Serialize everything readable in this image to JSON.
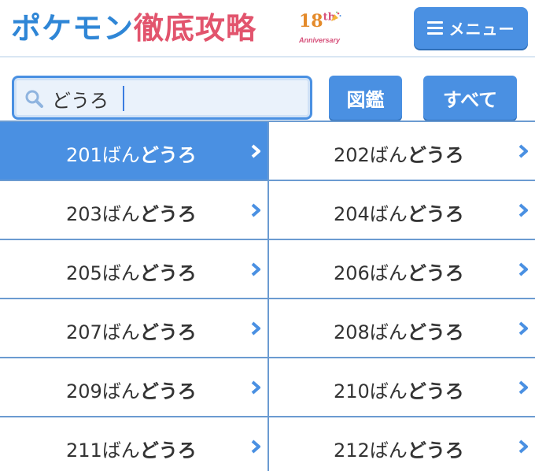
{
  "header": {
    "logo_part1": "ポケモン",
    "logo_part2": "徹底攻略",
    "anniv_number": "18",
    "anniv_suffix": "th",
    "anniv_word": "Anniversary",
    "menu_label": "メニュー"
  },
  "search": {
    "value": "どうろ",
    "zukan_label": "図鑑",
    "all_label": "すべて"
  },
  "routes": [
    {
      "num": "201",
      "suffix": "ばん",
      "road": "どうろ",
      "active": true
    },
    {
      "num": "202",
      "suffix": "ばん",
      "road": "どうろ",
      "active": false
    },
    {
      "num": "203",
      "suffix": "ばん",
      "road": "どうろ",
      "active": false
    },
    {
      "num": "204",
      "suffix": "ばん",
      "road": "どうろ",
      "active": false
    },
    {
      "num": "205",
      "suffix": "ばん",
      "road": "どうろ",
      "active": false
    },
    {
      "num": "206",
      "suffix": "ばん",
      "road": "どうろ",
      "active": false
    },
    {
      "num": "207",
      "suffix": "ばん",
      "road": "どうろ",
      "active": false
    },
    {
      "num": "208",
      "suffix": "ばん",
      "road": "どうろ",
      "active": false
    },
    {
      "num": "209",
      "suffix": "ばん",
      "road": "どうろ",
      "active": false
    },
    {
      "num": "210",
      "suffix": "ばん",
      "road": "どうろ",
      "active": false
    },
    {
      "num": "211",
      "suffix": "ばん",
      "road": "どうろ",
      "active": false
    },
    {
      "num": "212",
      "suffix": "ばん",
      "road": "どうろ",
      "active": false
    }
  ],
  "colors": {
    "accent": "#4a90e2",
    "border": "#6b9bd1",
    "logo_blue": "#2f86d6",
    "logo_red": "#e2546d"
  },
  "icons": {
    "menu": "hamburger-icon",
    "search": "magnifier-icon",
    "row_arrow": "chevron-right-icon",
    "anniversary": "party-popper-icon"
  }
}
